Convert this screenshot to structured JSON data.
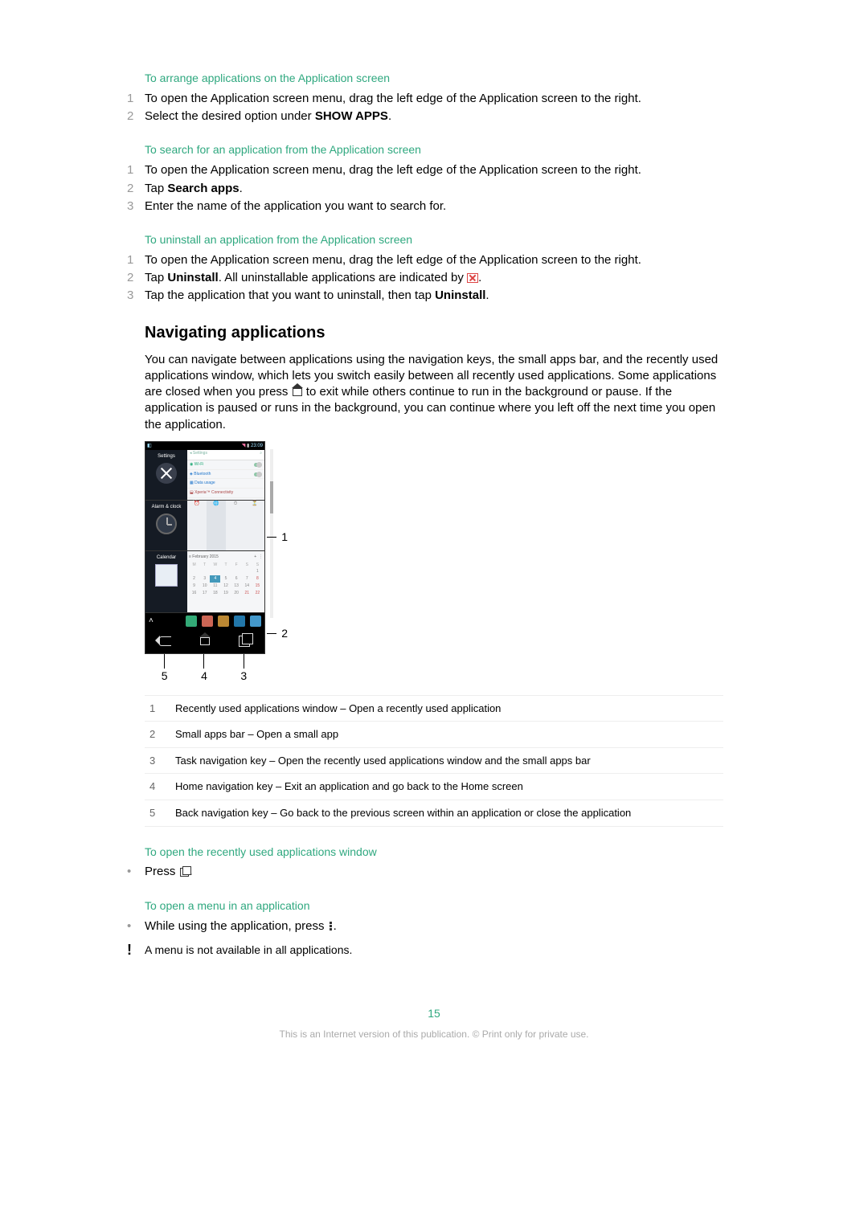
{
  "sections": {
    "arrange": {
      "heading": "To arrange applications on the Application screen",
      "steps": [
        {
          "n": "1",
          "pre": "To open the Application screen menu, drag the left edge of the Application screen to the right."
        },
        {
          "n": "2",
          "pre": "Select the desired option under ",
          "b": "SHOW APPS",
          "post": "."
        }
      ]
    },
    "search": {
      "heading": "To search for an application from the Application screen",
      "steps": [
        {
          "n": "1",
          "pre": "To open the Application screen menu, drag the left edge of the Application screen to the right."
        },
        {
          "n": "2",
          "pre": "Tap ",
          "b": "Search apps",
          "post": "."
        },
        {
          "n": "3",
          "pre": "Enter the name of the application you want to search for."
        }
      ]
    },
    "uninstall": {
      "heading": "To uninstall an application from the Application screen",
      "steps": [
        {
          "n": "1",
          "pre": "To open the Application screen menu, drag the left edge of the Application screen to the right."
        },
        {
          "n": "2",
          "pre": "Tap ",
          "b": "Uninstall",
          "post": ". All uninstallable applications are indicated by ",
          "icon": "x",
          "tail": "."
        },
        {
          "n": "3",
          "pre": "Tap the application that you want to uninstall, then tap ",
          "b": "Uninstall",
          "post": "."
        }
      ]
    }
  },
  "nav": {
    "heading": "Navigating applications",
    "para_pre": "You can navigate between applications using the navigation keys, the small apps bar, and the recently used applications window, which lets you switch easily between all recently used applications. Some applications are closed when you press ",
    "para_post": " to exit while others continue to run in the background or pause. If the application is paused or runs in the background, you can continue where you left off the next time you open the application."
  },
  "figure": {
    "status_time": "23:09",
    "rows": [
      {
        "label": "Settings"
      },
      {
        "label": "Alarm & clock"
      },
      {
        "label": "Calendar"
      }
    ],
    "annot": {
      "a1": "1",
      "a2": "2",
      "a3": "3",
      "a4": "4",
      "a5": "5"
    }
  },
  "legend": [
    {
      "n": "1",
      "t": "Recently used applications window – Open a recently used application"
    },
    {
      "n": "2",
      "t": "Small apps bar – Open a small app"
    },
    {
      "n": "3",
      "t": "Task navigation key – Open the recently used applications window and the small apps bar"
    },
    {
      "n": "4",
      "t": "Home navigation key – Exit an application and go back to the Home screen"
    },
    {
      "n": "5",
      "t": "Back navigation key – Go back to the previous screen within an application or close the application"
    }
  ],
  "open_recent": {
    "heading": "To open the recently used applications window",
    "line_pre": "Press ",
    "line_post": "."
  },
  "open_menu": {
    "heading": "To open a menu in an application",
    "line_pre": "While using the application, press ",
    "line_post": ".",
    "note": "A menu is not available in all applications."
  },
  "page_number": "15",
  "footer": "This is an Internet version of this publication. © Print only for private use."
}
